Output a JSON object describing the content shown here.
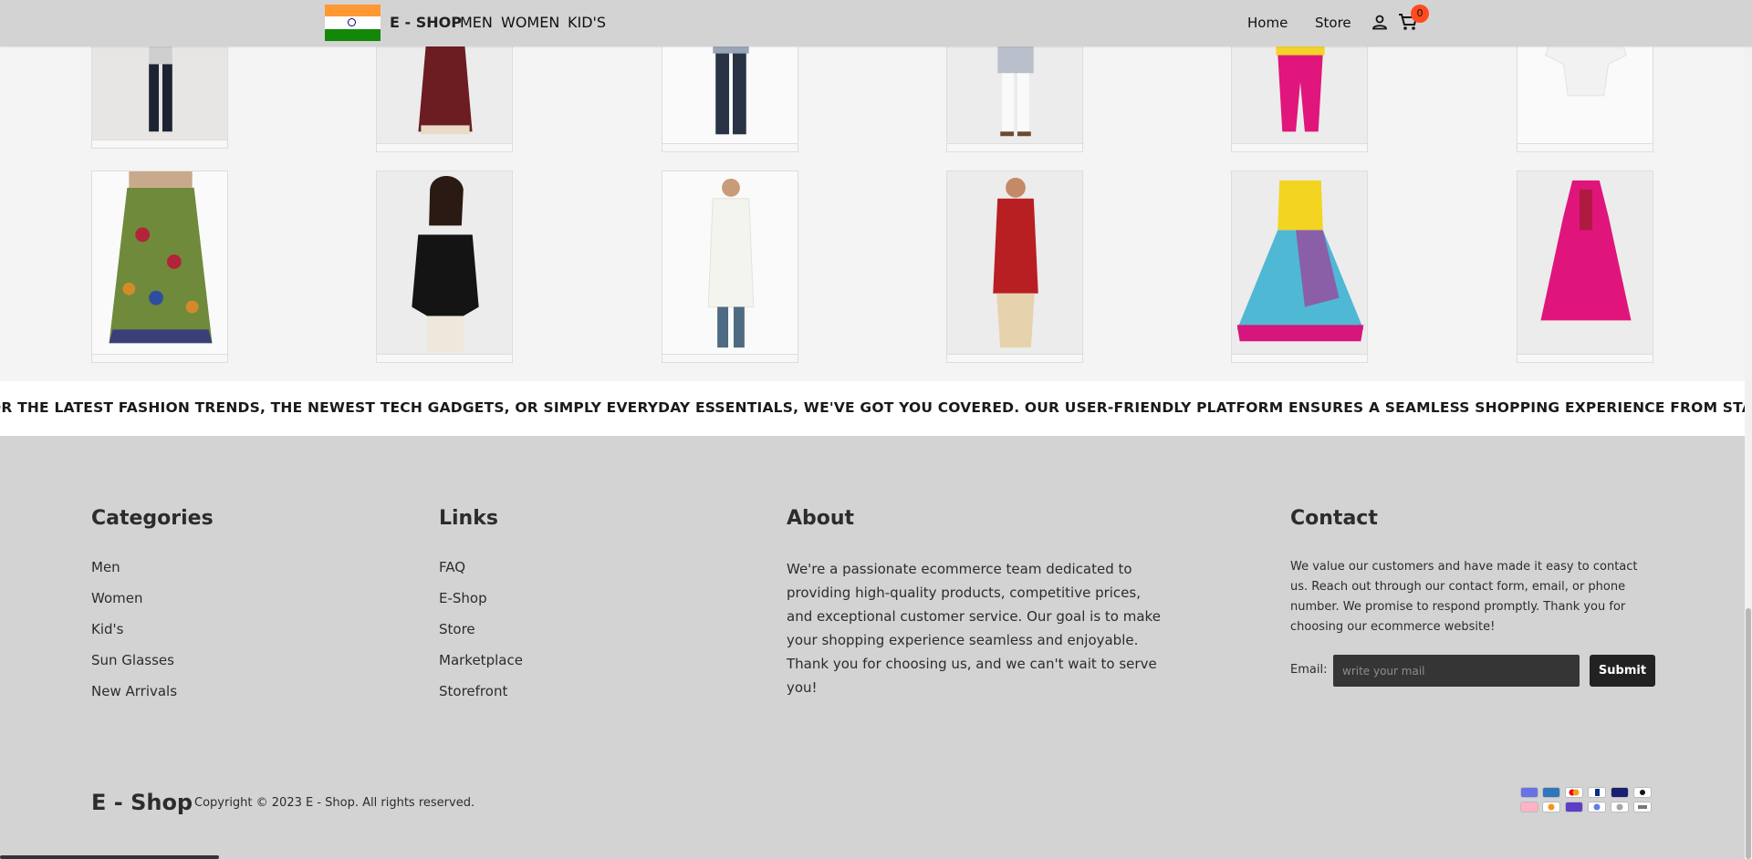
{
  "header": {
    "brand": "E - SHOP",
    "nav_left": [
      "MEN",
      "WOMEN",
      "KID'S"
    ],
    "nav_right": [
      "Home",
      "Store"
    ],
    "cart_count": "0",
    "icons": [
      "flag-india-icon",
      "user-icon",
      "cart-icon"
    ]
  },
  "products": {
    "row1": [
      "kurti-leggings",
      "maroon-skirt",
      "mens-shirt-jeans",
      "mens-kurta-white-pants",
      "girls-yellow-pink-outfit",
      "white-shirt"
    ],
    "row2": [
      "green-printed-skirt",
      "black-top",
      "white-kurta",
      "red-kurta",
      "kids-lehenga",
      "pink-frock"
    ]
  },
  "marquee": {
    "text": "OR THE LATEST FASHION TRENDS, THE NEWEST TECH GADGETS, OR SIMPLY EVERYDAY ESSENTIALS, WE'VE GOT YOU COVERED. OUR USER-FRIENDLY PLATFORM ENSURES A SEAMLESS SHOPPING EXPERIENCE FROM START TO FINISH, WITH EASY NAVIGAT"
  },
  "footer": {
    "categories": {
      "title": "Categories",
      "items": [
        "Men",
        "Women",
        "Kid's",
        "Sun Glasses",
        "New Arrivals"
      ]
    },
    "links": {
      "title": "Links",
      "items": [
        "FAQ",
        "E-Shop",
        "Store",
        "Marketplace",
        "Storefront"
      ]
    },
    "about": {
      "title": "About",
      "text": "We're a passionate ecommerce team dedicated to providing high-quality products, competitive prices, and exceptional customer service. Our goal is to make your shopping experience seamless and enjoyable. Thank you for choosing us, and we can't wait to serve you!"
    },
    "contact": {
      "title": "Contact",
      "text": "We value our customers and have made it easy to contact us. Reach out through our contact form, email, or phone number. We promise to respond promptly. Thank you for choosing our ecommerce website!",
      "email_label": "Email:",
      "email_placeholder": "write your mail",
      "email_value": "",
      "submit_label": "Submit"
    },
    "logo": "E - Shop",
    "copyright": "Copyright © 2023 E - Shop. All rights reserved.",
    "payment_icons": [
      "stripe-icon",
      "amex-icon",
      "mastercard-icon",
      "paypal-icon",
      "visa-icon",
      "apple-pay-icon",
      "klarna-icon",
      "bitcoin-icon",
      "gpay-icon",
      "ethereum-icon",
      "litecoin-icon",
      "google-pay-icon"
    ]
  },
  "colors": {
    "header_bg": "#d3d3d3",
    "footer_bg": "#d3d3d3",
    "badge": "#ff4b1f",
    "input_bg": "#353535",
    "button_bg": "#222222"
  }
}
